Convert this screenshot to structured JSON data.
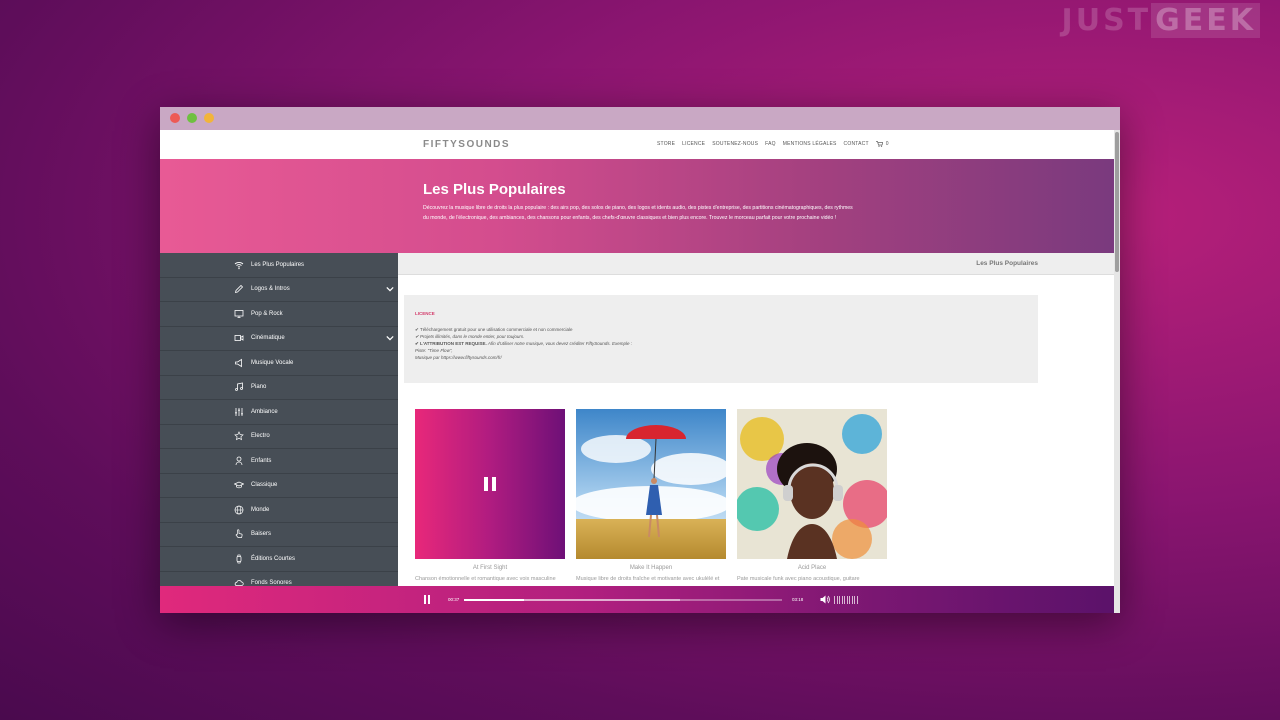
{
  "watermark": {
    "part1": "JUST",
    "part2": "GEEK"
  },
  "nav": {
    "logo": "FIFTYSOUNDS",
    "menu": [
      "STORE",
      "LICENCE",
      "SOUTENEZ-NOUS",
      "FAQ",
      "MENTIONS LÉGALES",
      "CONTACT"
    ],
    "cart_count": "0"
  },
  "hero": {
    "title": "Les Plus Populaires",
    "description": "Découvrez la musique libre de droits la plus populaire : des airs pop, des solos de piano, des logos et idents audio, des pistes d'entreprise, des partitions cinématographiques, des rythmes du monde, de l'électronique, des ambiances, des chansons pour enfants, des chefs-d'œuvre classiques et bien plus encore. Trouvez le morceau parfait pour votre prochaine vidéo !"
  },
  "sidebar": {
    "items": [
      {
        "label": "Les Plus Populaires",
        "icon": "wifi-icon",
        "has_children": false
      },
      {
        "label": "Logos & Intros",
        "icon": "pencil-icon",
        "has_children": true
      },
      {
        "label": "Pop & Rock",
        "icon": "monitor-icon",
        "has_children": false
      },
      {
        "label": "Cinématique",
        "icon": "camera-icon",
        "has_children": true
      },
      {
        "label": "Musique Vocale",
        "icon": "megaphone-icon",
        "has_children": false
      },
      {
        "label": "Piano",
        "icon": "music-note-icon",
        "has_children": false
      },
      {
        "label": "Ambiance",
        "icon": "equalizer-icon",
        "has_children": false
      },
      {
        "label": "Electro",
        "icon": "star-icon",
        "has_children": false
      },
      {
        "label": "Enfants",
        "icon": "child-icon",
        "has_children": false
      },
      {
        "label": "Classique",
        "icon": "mortarboard-icon",
        "has_children": false
      },
      {
        "label": "Monde",
        "icon": "globe-icon",
        "has_children": false
      },
      {
        "label": "Baisers",
        "icon": "hand-icon",
        "has_children": false
      },
      {
        "label": "Éditions Courtes",
        "icon": "watch-icon",
        "has_children": false
      },
      {
        "label": "Fonds Sonores",
        "icon": "cloud-icon",
        "has_children": false
      }
    ]
  },
  "content": {
    "header": "Les Plus Populaires",
    "license": {
      "title": "LICENCE",
      "line1": "✔ Téléchargement gratuit pour une utilisation commerciale et non commerciale",
      "line2": "✔ Projets illimités, dans le monde entier, pour toujours.",
      "line3_strong": "✔ L'ATTRIBUTION EST REQUISE.",
      "line3_rest": " Afin d'utiliser notre musique, vous devez créditer FiftySounds. Exemple :",
      "line4": "Piste: \"Time Flow\",",
      "line5": "Musique par https://www.fiftysounds.com/fr/"
    }
  },
  "cards": [
    {
      "title": "At First Sight",
      "description": "Chanson émotionnelle et romantique avec voix masculine",
      "state": "playing"
    },
    {
      "title": "Make It Happen",
      "description": "Musique libre de droits fraîche et motivante avec ukulélé et",
      "state": "idle"
    },
    {
      "title": "Acid Place",
      "description": "Pate musicale funk avec piano acoustique, guitare",
      "state": "idle"
    }
  ],
  "player": {
    "current_time": "00:37",
    "duration": "03:18",
    "progress": 0.19,
    "buffered": 0.68
  },
  "colors": {
    "accent_pink": "#e0297c",
    "sidebar_bg": "#474e56",
    "license_title": "#d23a6a"
  }
}
